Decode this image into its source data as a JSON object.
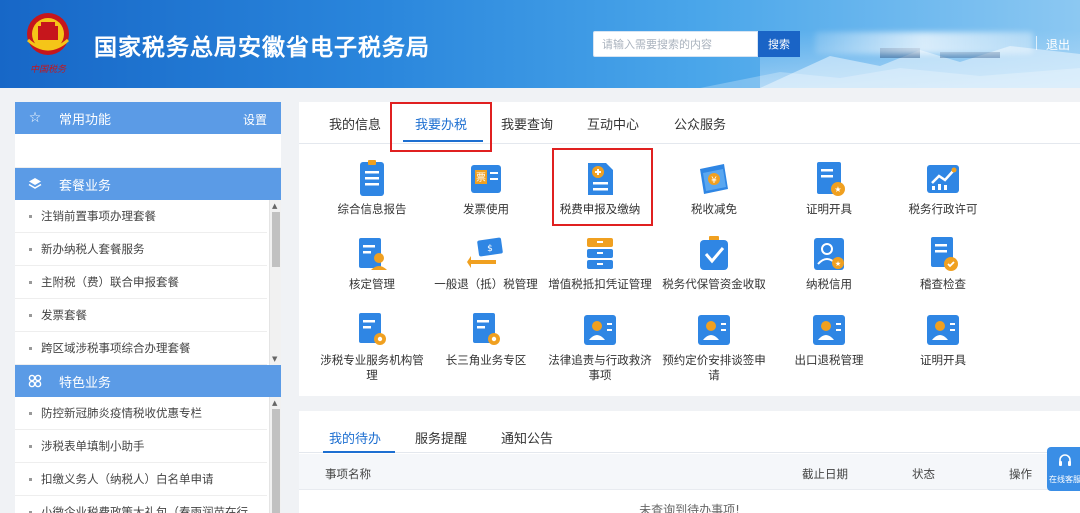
{
  "header": {
    "title": "国家税务总局安徽省电子税务局",
    "emblem_text": "中国税务",
    "search_placeholder": "请输入需要搜索的内容",
    "search_button": "搜索",
    "logout": "退出"
  },
  "sidebar": {
    "favorites": {
      "title": "常用功能",
      "settings": "设置",
      "icon": "star-outline-icon"
    },
    "packages": {
      "title": "套餐业务",
      "icon": "layers-icon",
      "items": [
        "注销前置事项办理套餐",
        "新办纳税人套餐服务",
        "主附税（费）联合申报套餐",
        "发票套餐",
        "跨区域涉税事项综合办理套餐"
      ]
    },
    "featured": {
      "title": "特色业务",
      "icon": "clover-icon",
      "items": [
        "防控新冠肺炎疫情税收优惠专栏",
        "涉税表单填制小助手",
        "扣缴义务人（纳税人）白名单申请",
        "小微企业税费政策大礼包（春雨润苗在行"
      ]
    }
  },
  "main": {
    "tabs": [
      "我的信息",
      "我要办税",
      "我要查询",
      "互动中心",
      "公众服务"
    ],
    "active_tab": "我要办税",
    "services": [
      {
        "label": "综合信息报告",
        "icon": "document-list-icon"
      },
      {
        "label": "发票使用",
        "icon": "invoice-icon"
      },
      {
        "label": "税费申报及缴纳",
        "icon": "tax-declare-icon"
      },
      {
        "label": "税收减免",
        "icon": "tax-reduction-icon"
      },
      {
        "label": "证明开具",
        "icon": "certificate-icon"
      },
      {
        "label": "税务行政许可",
        "icon": "chart-trend-icon"
      },
      {
        "label": "核定管理",
        "icon": "user-document-icon"
      },
      {
        "label": "一般退（抵）税管理",
        "icon": "refund-icon"
      },
      {
        "label": "增值税抵扣凭证管理",
        "icon": "cabinet-icon"
      },
      {
        "label": "税务代保管资金收取",
        "icon": "check-folder-icon"
      },
      {
        "label": "纳税信用",
        "icon": "user-star-icon"
      },
      {
        "label": "稽查检查",
        "icon": "document-check-icon"
      },
      {
        "label": "涉税专业服务机构管理",
        "icon": "document-gear-icon"
      },
      {
        "label": "长三角业务专区",
        "icon": "document-gear-icon"
      },
      {
        "label": "法律追责与行政救济事项",
        "icon": "user-card-icon"
      },
      {
        "label": "预约定价安排谈签申请",
        "icon": "user-card-icon"
      },
      {
        "label": "出口退税管理",
        "icon": "user-card-icon"
      },
      {
        "label": "证明开具",
        "icon": "user-card-icon"
      }
    ]
  },
  "todo": {
    "tabs": [
      "我的待办",
      "服务提醒",
      "通知公告"
    ],
    "columns": [
      "事项名称",
      "截止日期",
      "状态",
      "操作"
    ],
    "empty": "未查询到待办事项!"
  },
  "online_service": "在线客服",
  "colors": {
    "primary": "#1d6fd1",
    "sidebar_header": "#5b9be6",
    "highlight": "#e02020",
    "icon_blue": "#2f86e4"
  }
}
